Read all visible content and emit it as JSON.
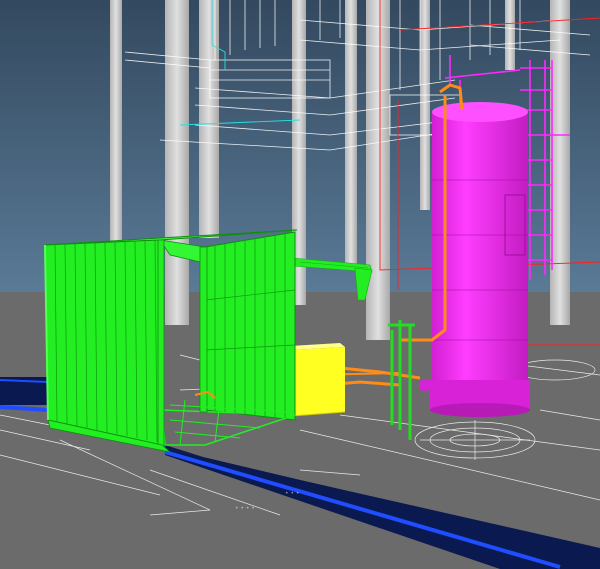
{
  "viewport": {
    "description_label": "",
    "colors": {
      "sky_top": "#33495f",
      "sky_bottom": "#5a7a96",
      "ground": "#6b6b6b",
      "walkway": "#0a1a50",
      "walkway_edge": "#1f4dff",
      "columns": "#c9c9c9",
      "wireframe": "#ffffff",
      "wire_red": "#ff2020",
      "wire_cyan": "#28e0e0",
      "enclosure": "#22ee22",
      "tank": "#ff28ff",
      "box": "#ffff22",
      "pipe_orange": "#ff8c1a",
      "pipe_green": "#22dd22"
    }
  }
}
